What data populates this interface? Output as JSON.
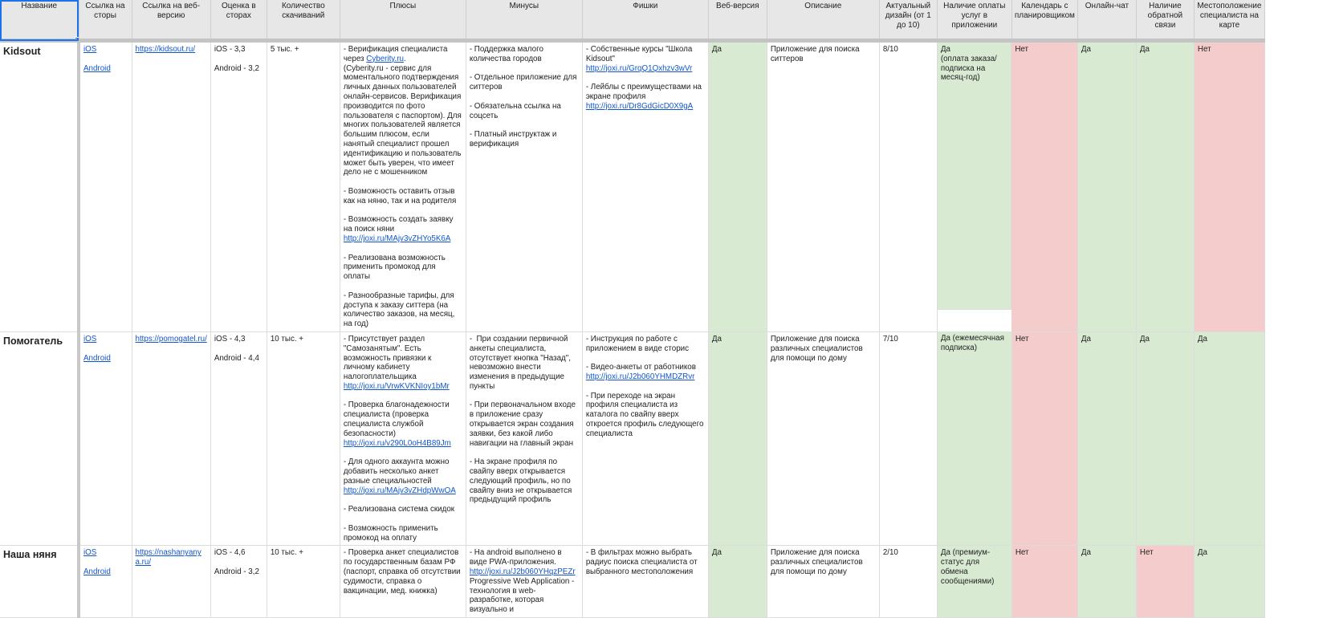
{
  "headers": [
    "Название",
    "Ссылка на сторы",
    "Ссылка на веб-версию",
    "Оценка в сторах",
    "Количество скачиваний",
    "Плюсы",
    "Минусы",
    "Фишки",
    "Веб-версия",
    "Описание",
    "Актуальный дизайн (от 1 до 10)",
    "Наличие оплаты услуг в приложении",
    "Календарь с планировщиком",
    "Онлайн-чат",
    "Наличие обратной связи",
    "Местоположение специалиста на карте"
  ],
  "rows": [
    {
      "name": "Kidsout",
      "ios": "iOS",
      "android": "Android",
      "web": "https://kidsout.ru/",
      "rating_ios": "iOS - 3,3",
      "rating_android": "Android - 3,2",
      "downloads": "5 тыс. +",
      "pros": [
        {
          "text": "- Верификация специалиста через ",
          "link": "Cyberity.ru",
          "after": ".\n(Cyberity.ru - сервис для моментального подтверждения личных данных пользователей онлайн-сервисов. Верификация производится по фото пользователя с паспортом). Для многих пользователей является большим плюсом, если нанятый специалист прошел идентификацию и пользователь может быть уверен, что имеет дело не с мошенником"
        },
        {
          "text": "- Возможность оставить отзыв как на няню, так и на родителя"
        },
        {
          "text": "- Возможность создать заявку на поиск няни",
          "link2": "http://joxi.ru/MAjv3vZHYo5K6A"
        },
        {
          "text": "- Реализована возможность применить промокод для оплаты"
        },
        {
          "text": "- Разнообразные тарифы, для доступа к заказу ситтера (на количество заказов, на месяц, на год)"
        }
      ],
      "cons": [
        {
          "text": "- Поддержка малого количества городов"
        },
        {
          "text": "- Отдельное приложение для ситтеров"
        },
        {
          "text": "- Обязательна ссылка на соцсеть"
        },
        {
          "text": "- Платный инструктаж и верификация"
        }
      ],
      "features": [
        {
          "text": "- Собственные курсы \"Школа Kidsout\"",
          "link2": "http://joxi.ru/GrqQ1Qxhzv3wVr"
        },
        {
          "text": "- Лейблы с преимуществами на экране профиля",
          "link2": "http://joxi.ru/Dr8GdGicD0X9gA"
        }
      ],
      "web_version": "Да",
      "description": "Приложение для поиска ситтеров",
      "design": "8/10",
      "payment": "Да\n(оплата заказа/подписка на месяц-год)",
      "calendar": "Нет",
      "chat": "Да",
      "feedback": "Да",
      "map": "Нет"
    },
    {
      "name": "Помогатель",
      "ios": "iOS",
      "android": "Android",
      "web": "https://pomogatel.ru/",
      "rating_ios": "iOS - 4,3",
      "rating_android": "Android - 4,4",
      "downloads": "10 тыс. +",
      "pros": [
        {
          "text": "- Присутствует раздел \"Самозанятым\". Есть возможность привязки к личному кабинету налогоплательщика",
          "link2": "http://joxi.ru/VrwKVKNIoy1bMr"
        },
        {
          "text": "- Проверка благонадежности специалиста (проверка специалиста службой безопасности)",
          "link2": "http://joxi.ru/v290L0oH4B89Jm"
        },
        {
          "text": "- Для одного аккаунта можно добавить несколько анкет разные специальностей",
          "link2": "http://joxi.ru/MAjv3vZHdpWwOA"
        },
        {
          "text": "- Реализована система скидок"
        },
        {
          "text": "- Возможность применить промокод на оплату"
        }
      ],
      "cons": [
        {
          "text": "-  При создании первичной анкеты специалиста, отсутствует кнопка \"Назад\", невозможно внести изменения в предыдущие пункты"
        },
        {
          "text": "- При первоначальном входе в приложение сразу открывается экран создания заявки, без какой либо навигации на главный экран"
        },
        {
          "text": "- На экране профиля по свайпу вверх открывается следующий профиль, но по свайпу вниз не открывается предыдущий профиль"
        }
      ],
      "features": [
        {
          "text": "- Инструкция по работе с приложением в виде сторис"
        },
        {
          "text": "- Видео-анкеты от работников",
          "link2": "http://joxi.ru/J2b060YHMDZRvr"
        },
        {
          "text": "- При переходе на экран профиля специалиста из каталога по свайпу вверх откроется профиль следующего специалиста"
        }
      ],
      "web_version": "Да",
      "description": "Приложение для поиска различных специалистов для помощи по дому",
      "design": "7/10",
      "payment": "Да (ежемесячная подписка)",
      "calendar": "Нет",
      "chat": "Да",
      "feedback": "Да",
      "map": "Да"
    },
    {
      "name": "Наша няня",
      "ios": "iOS",
      "android": "Android",
      "web": "https://nashanyanya.ru/",
      "rating_ios": "iOS - 4,6",
      "rating_android": "Android - 3,2",
      "downloads": "10 тыс. +",
      "pros": [
        {
          "text": "- Проверка анкет специалистов по государственным базам РФ (паспорт, справка об отсутствии судимости, справка о вакцинации, мед. книжка)"
        }
      ],
      "cons": [
        {
          "text": "- На android выполнено в виде PWA-приложения.",
          "link2": "http://joxi.ru/J2b060YHqzPEZr",
          "after2": "Progressive Web Application - технология в web-разработке, которая визуально и"
        }
      ],
      "features": [
        {
          "text": "- В фильтрах можно выбрать радиус поиска специалиста от выбранного местоположения"
        }
      ],
      "web_version": "Да",
      "description": "Приложение для поиска различных специалистов для помощи по дому",
      "design": "2/10",
      "payment": "Да (премиум-статус для обмена сообщениями)",
      "calendar": "Нет",
      "chat": "Да",
      "feedback": "Нет",
      "map": "Да"
    }
  ]
}
